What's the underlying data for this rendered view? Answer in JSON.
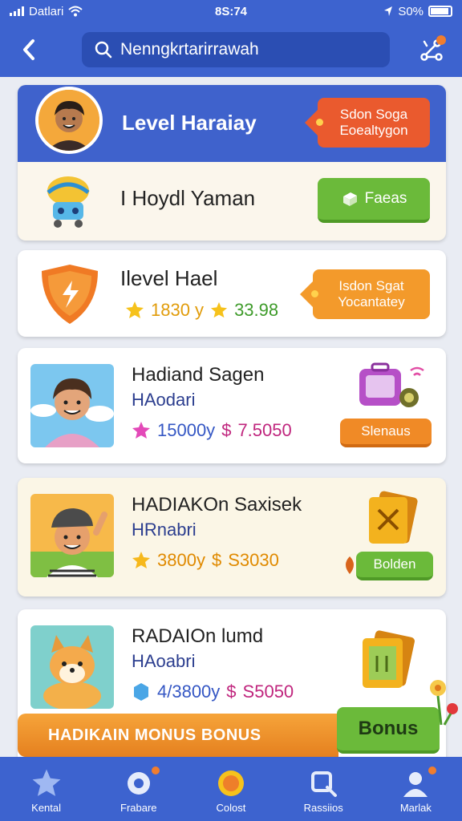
{
  "status_bar": {
    "carrier": "Datlari",
    "time": "8S:74",
    "battery": "S0%"
  },
  "header": {
    "search_value": "Nenngkrtarirrawah"
  },
  "cards": [
    {
      "title": "Level Haraiay",
      "tag_line1": "Sdon Soga",
      "tag_line2": "Eoealtygon",
      "row_title": "I Hoydl Yaman",
      "button": "Faeas"
    },
    {
      "title": "Ilevel Hael",
      "stat1": "1830 y",
      "stat2": "33.98",
      "tag_line1": "Isdon Sgat",
      "tag_line2": "Yocantatey"
    },
    {
      "name": "Hadiand Sagen",
      "sub": "HAodari",
      "stat1": "15000y",
      "stat2": "7.5050",
      "button": "Slenaus"
    },
    {
      "name": "HADIAKOn Saxisek",
      "sub": "HRnabri",
      "stat1": "3800y",
      "stat2": "S3030",
      "button": "Bolden"
    },
    {
      "name": "RADAIOn lumd",
      "sub": "HAoabri",
      "stat1": "4/3800y",
      "stat2": "S5050"
    }
  ],
  "banner": {
    "text": "HADIKAIN MONUS BONUS",
    "button": "Bonus"
  },
  "tabs": [
    {
      "label": "Kental",
      "icon": "star-icon"
    },
    {
      "label": "Frabare",
      "icon": "location-icon"
    },
    {
      "label": "Colost",
      "icon": "coin-icon"
    },
    {
      "label": "Rassiios",
      "icon": "search-icon"
    },
    {
      "label": "Marlak",
      "icon": "user-icon"
    }
  ],
  "colors": {
    "primary": "#3d63cf",
    "green": "#6bba3a",
    "orange": "#f08a26",
    "red": "#ea5a2e"
  }
}
